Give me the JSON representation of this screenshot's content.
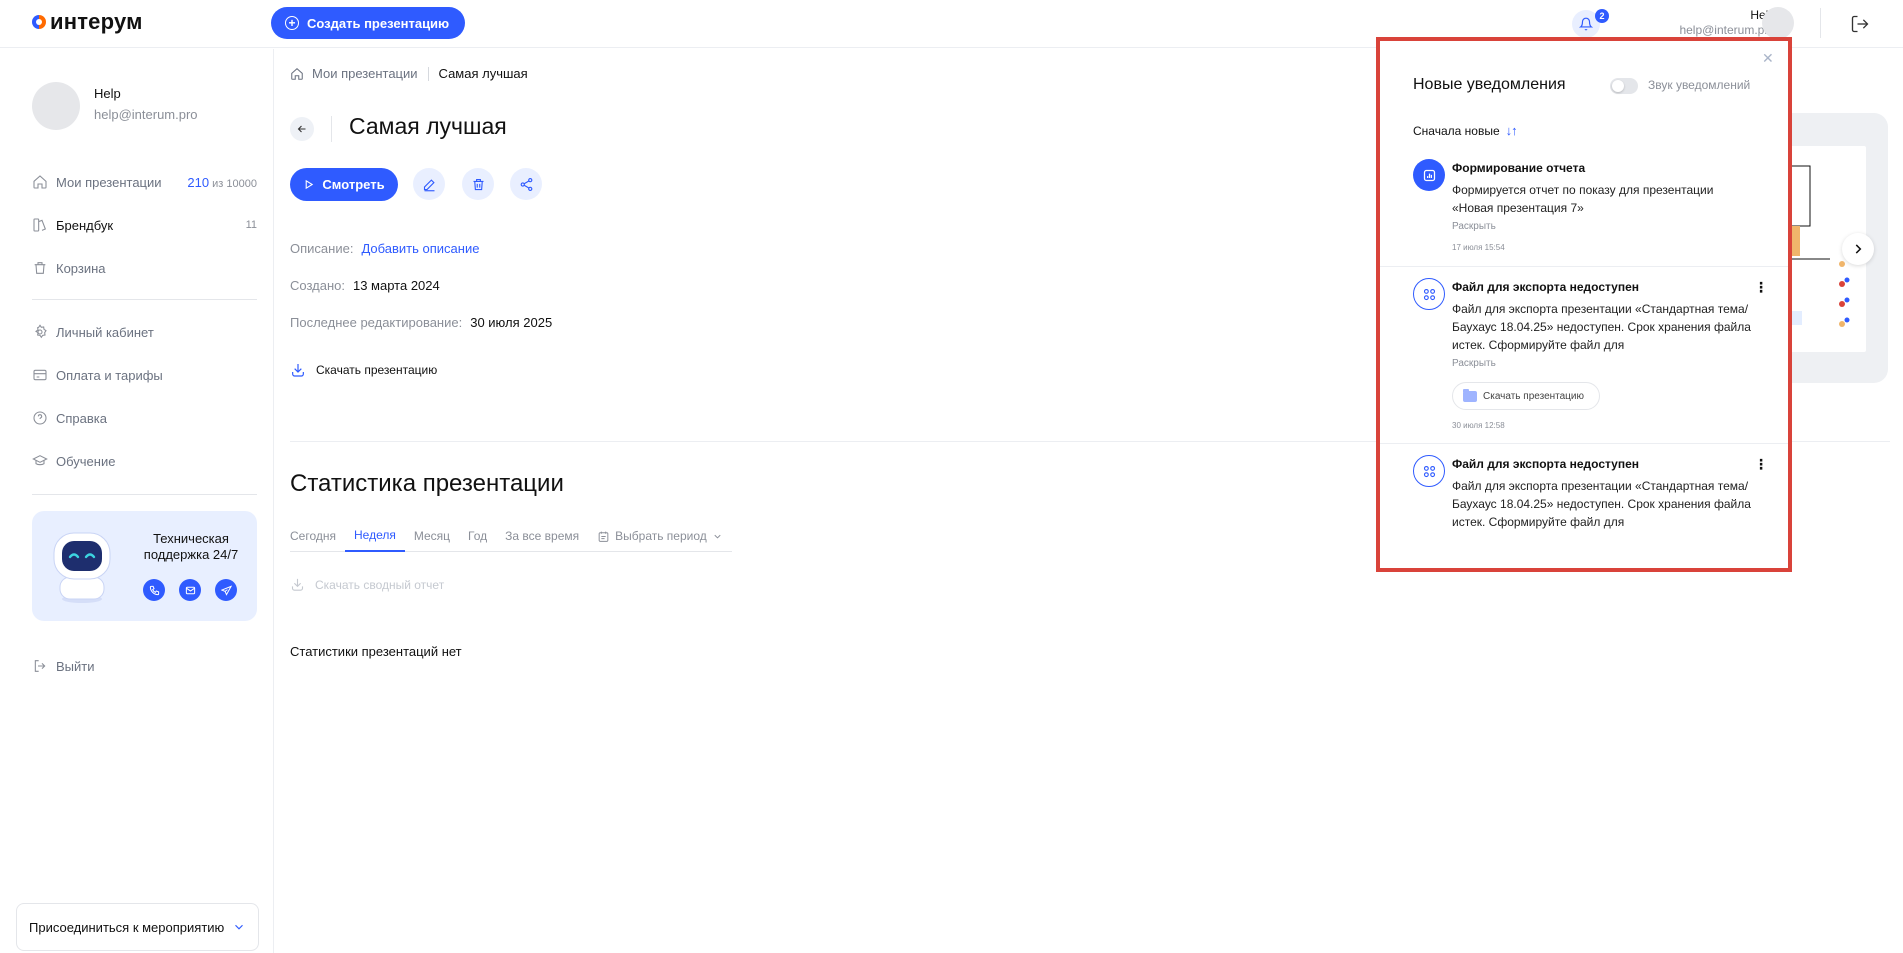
{
  "header": {
    "logo_text": "интерум",
    "create_label": "Создать презентацию",
    "notif_count": "2",
    "user_name": "Help",
    "user_email": "help@interum.pro"
  },
  "sidebar": {
    "user_name": "Help",
    "user_email": "help@interum.pro",
    "items": [
      {
        "label": "Мои презентации",
        "count": "210",
        "limit": "из 10000"
      },
      {
        "label": "Брендбук",
        "count": "11"
      },
      {
        "label": "Корзина"
      },
      {
        "label": "Личный кабинет"
      },
      {
        "label": "Оплата и тарифы"
      },
      {
        "label": "Справка"
      },
      {
        "label": "Обучение"
      }
    ],
    "support_text": "Техническая поддержка 24/7",
    "logout_label": "Выйти",
    "join_label": "Присоединиться к мероприятию"
  },
  "main": {
    "breadcrumb_root": "Мои презентации",
    "breadcrumb_current": "Самая лучшая",
    "title": "Самая лучшая",
    "watch_label": "Смотреть",
    "description_key": "Описание:",
    "description_link": "Добавить описание",
    "created_key": "Создано:",
    "created_value": "13 марта 2024",
    "edited_key": "Последнее редактирование:",
    "edited_value": "30 июля 2025",
    "download_label": "Скачать презентацию",
    "stats_title": "Статистика презентации",
    "tabs": [
      "Сегодня",
      "Неделя",
      "Месяц",
      "Год",
      "За все время",
      "Выбрать период"
    ],
    "active_tab": "Неделя",
    "summary_label": "Скачать сводный отчет",
    "no_stats": "Статистики презентаций нет"
  },
  "notifications": {
    "title": "Новые уведомления",
    "sound_label": "Звук уведомлений",
    "sort_label": "Сначала новые",
    "items": [
      {
        "title": "Формирование отчета",
        "text": "Формируется отчет по показу для презентации «Новая презентация 7»",
        "expand": "Раскрыть",
        "time": "17 июля 15:54"
      },
      {
        "title": "Файл для экспорта недоступен",
        "text": "Файл для экспорта презентации «Стандартная тема/Баухаус 18.04.25» недоступен. Срок хранения файла истек. Сформируйте файл для",
        "expand": "Раскрыть",
        "download": "Скачать презентацию",
        "time": "30 июля 12:58"
      },
      {
        "title": "Файл для экспорта недоступен",
        "text": "Файл для экспорта презентации «Стандартная тема/Баухаус 18.04.25» недоступен. Срок хранения файла истек. Сформируйте файл для"
      }
    ]
  },
  "colors": {
    "accent": "#2f5bff",
    "frame": "#d9433a"
  }
}
